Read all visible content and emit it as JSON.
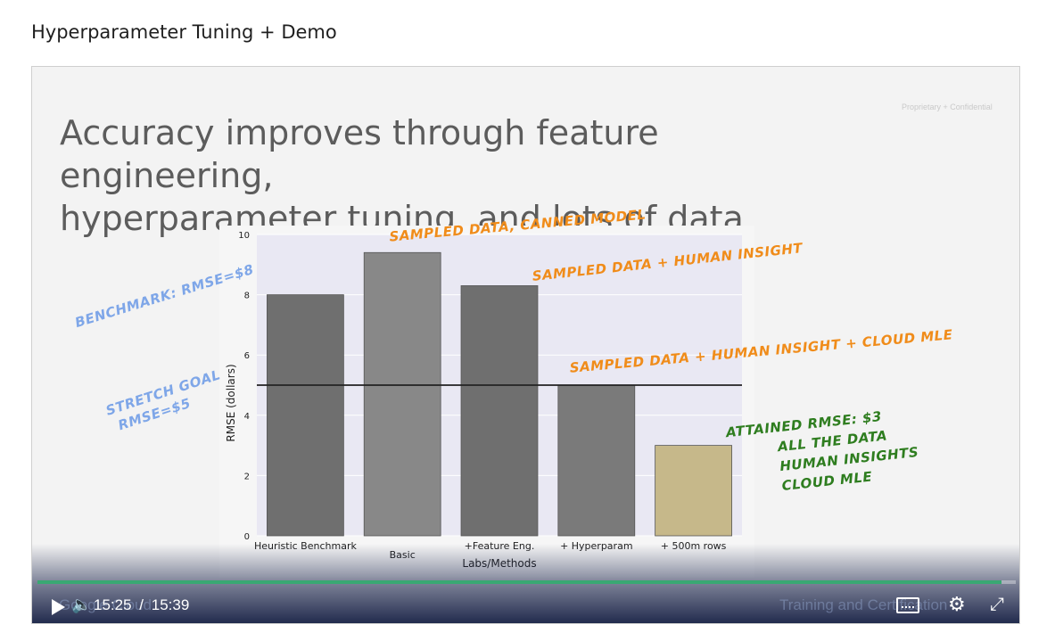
{
  "page": {
    "title": "Hyperparameter Tuning + Demo"
  },
  "slide": {
    "confidential": "Proprietary + Confidential",
    "title_line1": "Accuracy improves through feature engineering,",
    "title_line2": "hyperparameter tuning, and lots of data"
  },
  "chart_data": {
    "type": "bar",
    "categories": [
      "Heuristic Benchmark",
      "Basic",
      "+Feature Eng.",
      "+ Hyperparam",
      "+ 500m rows"
    ],
    "values": [
      8,
      9.4,
      8.3,
      5,
      3
    ],
    "colors": [
      "#6f6f6f",
      "#888888",
      "#6f6f6f",
      "#7a7a7a",
      "#c6b88a"
    ],
    "xlabel": "Labs/Methods",
    "ylabel": "RMSE (dollars)",
    "ylim": [
      0,
      10
    ],
    "yticks": [
      "0",
      "2",
      "4",
      "6",
      "8",
      "10"
    ],
    "reference_line": 5,
    "grid": true
  },
  "annotations": {
    "sampled_canned": "SAMPLED DATA, CANNED MODEL",
    "sampled_human": "SAMPLED DATA + HUMAN INSIGHT",
    "sampled_cloud": "SAMPLED DATA + HUMAN INSIGHT + CLOUD MLE",
    "benchmark": "BENCHMARK: RMSE=$8",
    "stretch_1": "STRETCH GOAL",
    "stretch_2": "RMSE=$5",
    "attained_1": "ATTAINED RMSE: $3",
    "attained_2": "ALL THE DATA",
    "attained_3": "HUMAN INSIGHTS",
    "attained_4": "CLOUD MLE"
  },
  "player": {
    "current_time": "15:25",
    "separator": "/",
    "duration": "15:39",
    "progress": 0.985,
    "watermark_left": "Google Cloud",
    "watermark_right": "Training and Certification",
    "accent": "#3aa873"
  }
}
